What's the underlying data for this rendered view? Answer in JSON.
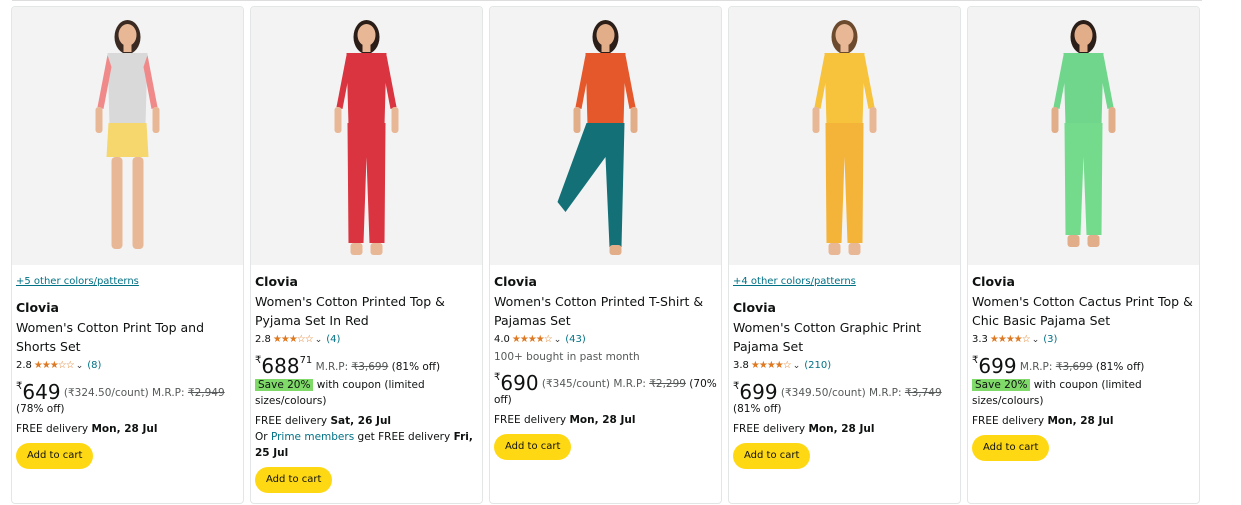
{
  "products": [
    {
      "colors_link": "+5 other colors/patterns",
      "brand": "Clovia",
      "title": "Women's Cotton Print Top and Shorts Set",
      "rating": "2.8",
      "reviews": "(8)",
      "bought": "",
      "price_symbol": "₹",
      "price": "649",
      "price_frac": "",
      "unit_price": "(₹324.50/count)",
      "mrp_label": "M.R.P:",
      "mrp": "₹2,949",
      "discount": "(78% off)",
      "coupon_badge": "",
      "coupon_text": "",
      "delivery_label": "FREE delivery",
      "delivery_date": "Mon, 28 Jul",
      "prime_prefix": "",
      "prime_link": "",
      "prime_suffix": "",
      "prime_date": "",
      "button": "Add to cart",
      "stars_fill": 2.8
    },
    {
      "colors_link": "",
      "brand": "Clovia",
      "title": "Women's Cotton Printed Top & Pyjama Set In Red",
      "rating": "2.8",
      "reviews": "(4)",
      "bought": "",
      "price_symbol": "₹",
      "price": "688",
      "price_frac": "71",
      "unit_price": "",
      "mrp_label": "M.R.P:",
      "mrp": "₹3,699",
      "discount": "(81% off)",
      "coupon_badge": "Save 20%",
      "coupon_text": "with coupon (limited sizes/colours)",
      "delivery_label": "FREE delivery",
      "delivery_date": "Sat, 26 Jul",
      "prime_prefix": "Or",
      "prime_link": "Prime members",
      "prime_suffix": "get FREE delivery",
      "prime_date": "Fri, 25 Jul",
      "button": "Add to cart",
      "stars_fill": 2.8
    },
    {
      "colors_link": "",
      "brand": "Clovia",
      "title": "Women's Cotton Printed T-Shirt & Pajamas Set",
      "rating": "4.0",
      "reviews": "(43)",
      "bought": "100+ bought in past month",
      "price_symbol": "₹",
      "price": "690",
      "price_frac": "",
      "unit_price": "(₹345/count)",
      "mrp_label": "M.R.P:",
      "mrp": "₹2,299",
      "discount": "(70% off)",
      "coupon_badge": "",
      "coupon_text": "",
      "delivery_label": "FREE delivery",
      "delivery_date": "Mon, 28 Jul",
      "prime_prefix": "",
      "prime_link": "",
      "prime_suffix": "",
      "prime_date": "",
      "button": "Add to cart",
      "stars_fill": 4.0
    },
    {
      "colors_link": "+4 other colors/patterns",
      "brand": "Clovia",
      "title": "Women's Cotton Graphic Print Pajama Set",
      "rating": "3.8",
      "reviews": "(210)",
      "bought": "",
      "price_symbol": "₹",
      "price": "699",
      "price_frac": "",
      "unit_price": "(₹349.50/count)",
      "mrp_label": "M.R.P:",
      "mrp": "₹3,749",
      "discount": "(81% off)",
      "coupon_badge": "",
      "coupon_text": "",
      "delivery_label": "FREE delivery",
      "delivery_date": "Mon, 28 Jul",
      "prime_prefix": "",
      "prime_link": "",
      "prime_suffix": "",
      "prime_date": "",
      "button": "Add to cart",
      "stars_fill": 3.8
    },
    {
      "colors_link": "",
      "brand": "Clovia",
      "title": "Women's Cotton Cactus Print Top & Chic Basic Pajama Set",
      "rating": "3.3",
      "reviews": "(3)",
      "bought": "",
      "price_symbol": "₹",
      "price": "699",
      "price_frac": "",
      "unit_price": "",
      "mrp_label": "M.R.P:",
      "mrp": "₹3,699",
      "discount": "(81% off)",
      "coupon_badge": "Save 20%",
      "coupon_text": "with coupon (limited sizes/colours)",
      "delivery_label": "FREE delivery",
      "delivery_date": "Mon, 28 Jul",
      "prime_prefix": "",
      "prime_link": "",
      "prime_suffix": "",
      "prime_date": "",
      "button": "Add to cart",
      "stars_fill": 3.3
    }
  ],
  "images": [
    {
      "top": "#d9d9d9",
      "sleeve": "#f08a8a",
      "bottom": "#f5d76e",
      "bottom_type": "shorts",
      "skin": "#e8b796",
      "hair": "#3b2a22",
      "icon": "model-photo"
    },
    {
      "top": "#d9343f",
      "sleeve": "#d9343f",
      "bottom": "#d9343f",
      "bottom_type": "pants",
      "skin": "#e8b796",
      "hair": "#2b1d17",
      "icon": "model-photo"
    },
    {
      "top": "#e5582b",
      "sleeve": "#e5582b",
      "bottom": "#137076",
      "bottom_type": "pants-pose",
      "skin": "#e2ad89",
      "hair": "#2b1d17",
      "icon": "model-photo"
    },
    {
      "top": "#f7c23c",
      "sleeve": "#f7c23c",
      "bottom": "#f4b43a",
      "bottom_type": "pants",
      "skin": "#e8b796",
      "hair": "#6b4a2e",
      "icon": "model-photo"
    },
    {
      "top": "#6fd68b",
      "sleeve": "#6fd68b",
      "bottom": "#74db8c",
      "bottom_type": "joggers",
      "skin": "#e2ad89",
      "hair": "#2b1d17",
      "icon": "model-photo"
    }
  ]
}
